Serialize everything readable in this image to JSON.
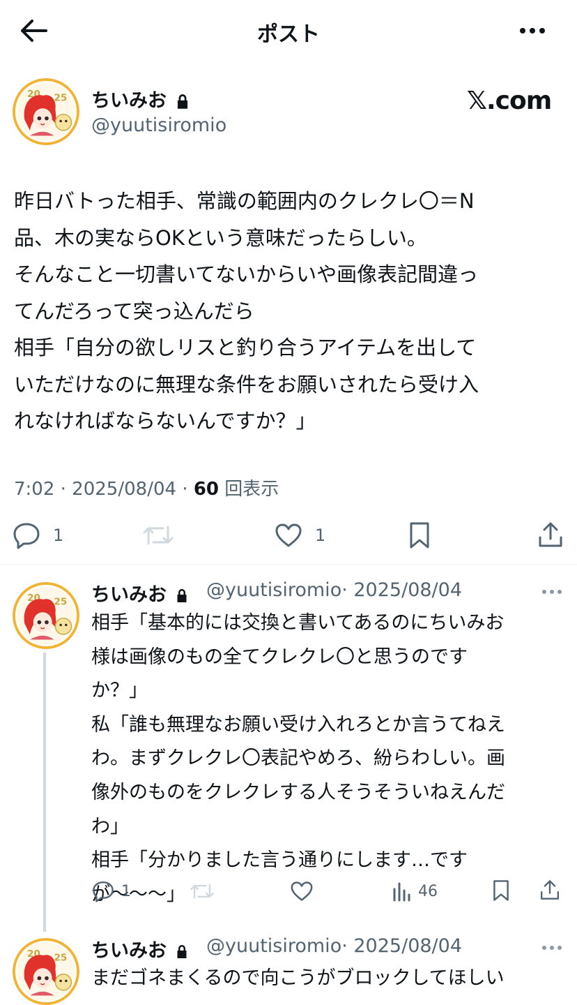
{
  "header": {
    "title": "ポスト"
  },
  "main_post": {
    "name": "ちいみお",
    "handle": "@yuutisiromio",
    "brand": "𝕏.com",
    "text_lines": [
      "昨日バトった相手、常識の範囲内のクレクレ〇＝N",
      "品、木の実ならOKという意味だったらしい。",
      "そんなこと一切書いてないからいや画像表記間違っ",
      "てんだろって突っ込んだら",
      "相手「自分の欲しリスと釣り合うアイテムを出して",
      "いただけなのに無理な条件をお願いされたら受け入",
      "れなければならないんですか？」"
    ],
    "time": "7:02 · 2025/08/04 · ",
    "views": "60",
    "views_label": " 回表示",
    "reply_count": "1",
    "like_count": "1"
  },
  "replies": [
    {
      "name": "ちいみお",
      "handle": "@yuutisiromio",
      "date": "· 2025/08/04",
      "text_lines": [
        "相手「基本的には交換と書いてあるのにちいみお",
        "様は画像のもの全てクレクレ〇と思うのです",
        "か？」",
        "私「誰も無理なお願い受け入れろとか言うてねえ",
        "わ。まずクレクレ〇表記やめろ、紛らわしい。画",
        "像外のものをクレクレする人そうそういねえんだ",
        "わ」",
        "相手「分かりました言う通りにします…です",
        "が〜〜〜」"
      ],
      "reply_count": "1",
      "view_count": "46"
    },
    {
      "name": "ちいみお",
      "handle": "@yuutisiromio",
      "date": "· 2025/08/04",
      "text_lines": [
        "まだゴネまくるので向こうがブロックしてほしい"
      ]
    }
  ],
  "colors": {
    "text": "#0f1419",
    "secondary": "#536471",
    "avatar_ring": "#f2b233",
    "hair": "#e0312b"
  }
}
